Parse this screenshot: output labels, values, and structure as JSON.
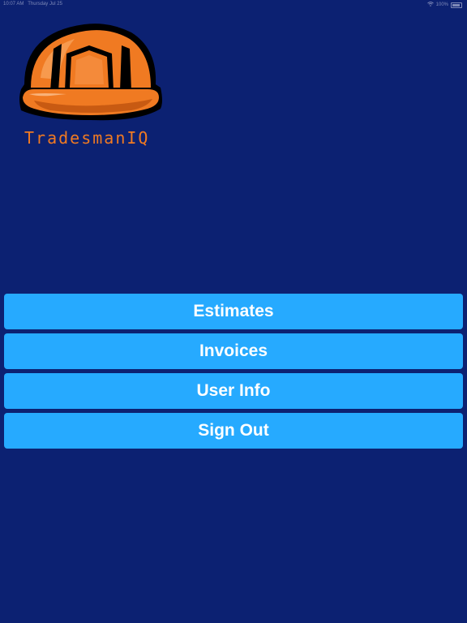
{
  "status_bar": {
    "time": "10:07 AM",
    "date": "Thursday Jul 25",
    "battery": "100%"
  },
  "brand": {
    "name": "TradesmanIQ",
    "logo_icon": "hard-hat-icon",
    "colors": {
      "helmet": "#f07a22",
      "text": "#f07a22",
      "background": "#0c2172",
      "button": "#26aaff"
    }
  },
  "menu": {
    "estimates_label": "Estimates",
    "invoices_label": "Invoices",
    "user_info_label": "User Info",
    "sign_out_label": "Sign Out"
  }
}
